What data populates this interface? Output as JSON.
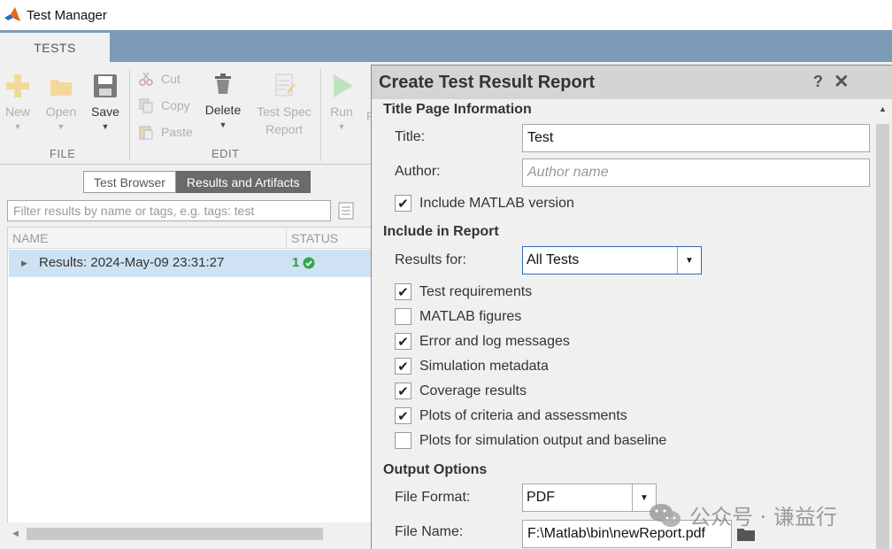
{
  "window": {
    "title": "Test Manager"
  },
  "tabs": [
    {
      "label": "TESTS"
    }
  ],
  "ribbon": {
    "file": {
      "label": "FILE",
      "new": "New",
      "open": "Open",
      "save": "Save"
    },
    "edit": {
      "label": "EDIT",
      "cut": "Cut",
      "copy": "Copy",
      "paste": "Paste",
      "delete": "Delete",
      "test_spec_report": [
        "Test Spec",
        "Report"
      ]
    },
    "run": "Run",
    "partial_label": "F"
  },
  "left_pane": {
    "view_tabs": [
      "Test Browser",
      "Results and Artifacts"
    ],
    "active_view": "Results and Artifacts",
    "filter_placeholder": "Filter results by name or tags, e.g. tags: test",
    "table": {
      "columns": [
        "NAME",
        "STATUS"
      ],
      "rows": [
        {
          "name": "Results: 2024-May-09 23:31:27",
          "status_count": "1",
          "status": "passed"
        }
      ]
    }
  },
  "dialog": {
    "title": "Create Test Result Report",
    "help": "?",
    "close": "✕",
    "title_page": {
      "heading": "Title Page Information",
      "title_label": "Title:",
      "title_value": "Test",
      "author_label": "Author:",
      "author_placeholder": "Author name",
      "include_version": {
        "label": "Include MATLAB version",
        "checked": true
      }
    },
    "include": {
      "heading": "Include in Report",
      "results_for_label": "Results for:",
      "results_for_value": "All Tests",
      "options": [
        {
          "label": "Test requirements",
          "checked": true
        },
        {
          "label": "MATLAB figures",
          "checked": false
        },
        {
          "label": "Error and log messages",
          "checked": true
        },
        {
          "label": "Simulation metadata",
          "checked": true
        },
        {
          "label": "Coverage results",
          "checked": true
        },
        {
          "label": "Plots of criteria and assessments",
          "checked": true
        },
        {
          "label": "Plots for simulation output and baseline",
          "checked": false
        }
      ]
    },
    "output": {
      "heading": "Output Options",
      "format_label": "File Format:",
      "format_value": "PDF",
      "filename_label": "File Name:",
      "filename_value": "F:\\Matlab\\bin\\newReport.pdf"
    }
  },
  "watermark": "公众号 · 谦益行",
  "colors": {
    "tab_strip": "#7c9bb7",
    "selected_row": "#cfe2f3",
    "pass_green": "#2a9d3c",
    "dropdown_focus": "#2f6cb5"
  }
}
